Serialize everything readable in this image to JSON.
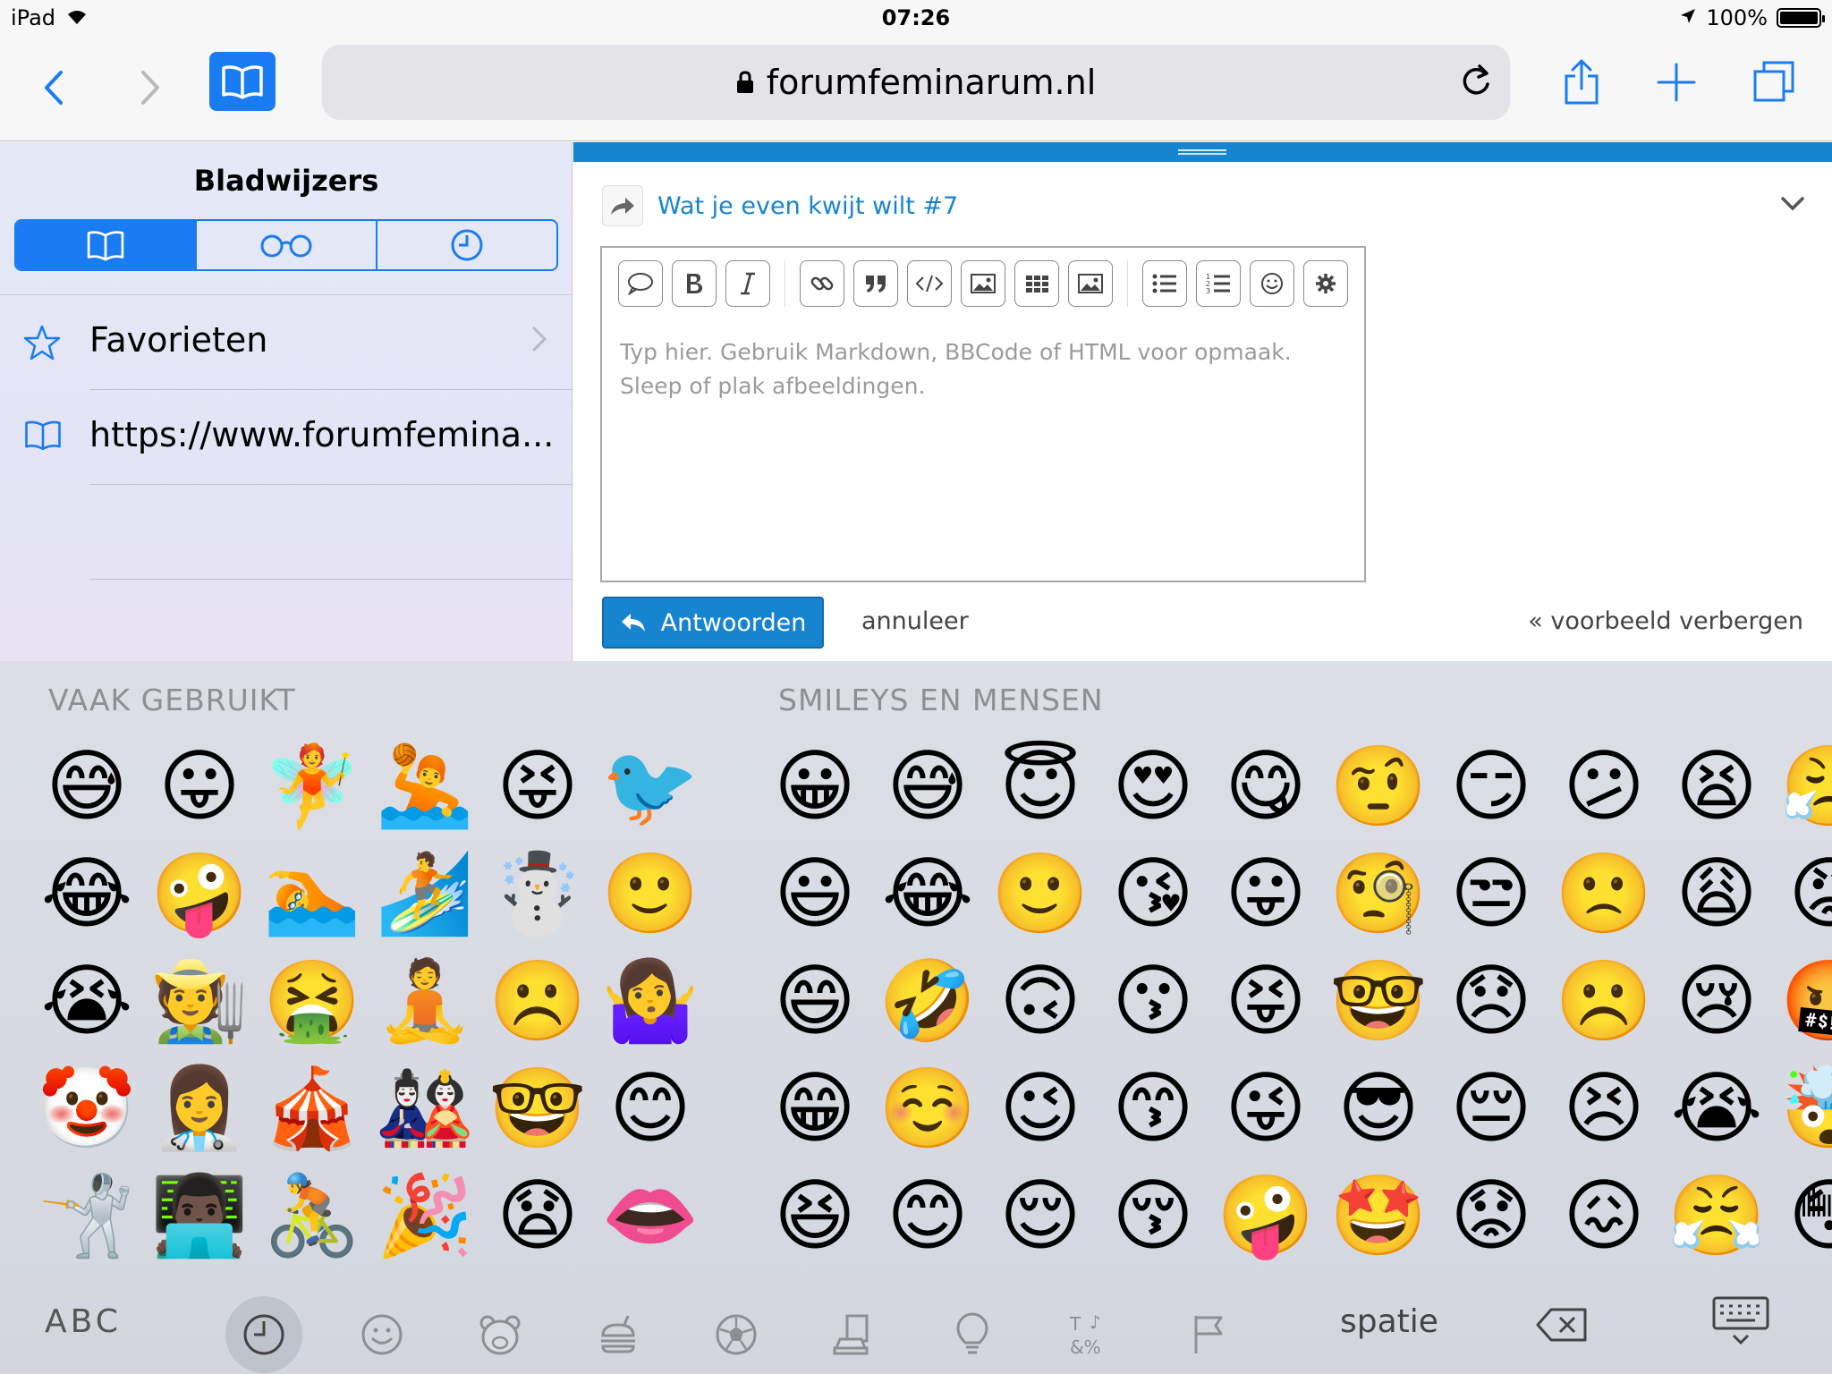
{
  "status": {
    "device": "iPad",
    "time": "07:26",
    "battery": "100%"
  },
  "browser": {
    "url": "forumfeminarum.nl"
  },
  "sidebar": {
    "title": "Bladwijzers",
    "items": [
      {
        "label": "Favorieten"
      },
      {
        "label": "https://www.forumfemina..."
      }
    ]
  },
  "web": {
    "thread_title": "Wat je even kwijt wilt #7",
    "placeholder": "Typ hier. Gebruik Markdown, BBCode of HTML voor opmaak. Sleep of plak afbeeldingen.",
    "reply_label": "Antwoorden",
    "cancel_label": "annuleer",
    "preview_label": "« voorbeeld verbergen"
  },
  "keyboard": {
    "section_frequent": "VAAK GEBRUIKT",
    "section_smileys": "SMILEYS EN MENSEN",
    "frequent": [
      "😅",
      "😛",
      "🧚",
      "🤽",
      "😝",
      "🐦",
      "😂",
      "🤪",
      "🏊",
      "🏄",
      "☃️",
      "🙂",
      "😭",
      "🧑‍🌾",
      "🤮",
      "🧘",
      "☹️",
      "🤷‍♀️",
      "🤡",
      "👩‍⚕️",
      "🎪",
      "🎎",
      "🤓",
      "😊",
      "🤺",
      "👨🏿‍💻",
      "🚴",
      "🎉",
      "😧",
      "👄"
    ],
    "smileys": [
      "😀",
      "😅",
      "😇",
      "😍",
      "😋",
      "🤨",
      "😏",
      "😕",
      "😫",
      "😤",
      "😃",
      "😂",
      "🙂",
      "😘",
      "😛",
      "🧐",
      "😒",
      "🙁",
      "😩",
      "😡",
      "😄",
      "🤣",
      "🙃",
      "😗",
      "😝",
      "🤓",
      "😞",
      "☹️",
      "😢",
      "🤬",
      "😁",
      "☺️",
      "😉",
      "😙",
      "😜",
      "😎",
      "😔",
      "😣",
      "😭",
      "🤯",
      "😆",
      "😊",
      "😌",
      "😚",
      "🤪",
      "🤩",
      "😟",
      "😖",
      "😤",
      "😳"
    ],
    "abc_label": "ABC",
    "space_label": "spatie"
  }
}
